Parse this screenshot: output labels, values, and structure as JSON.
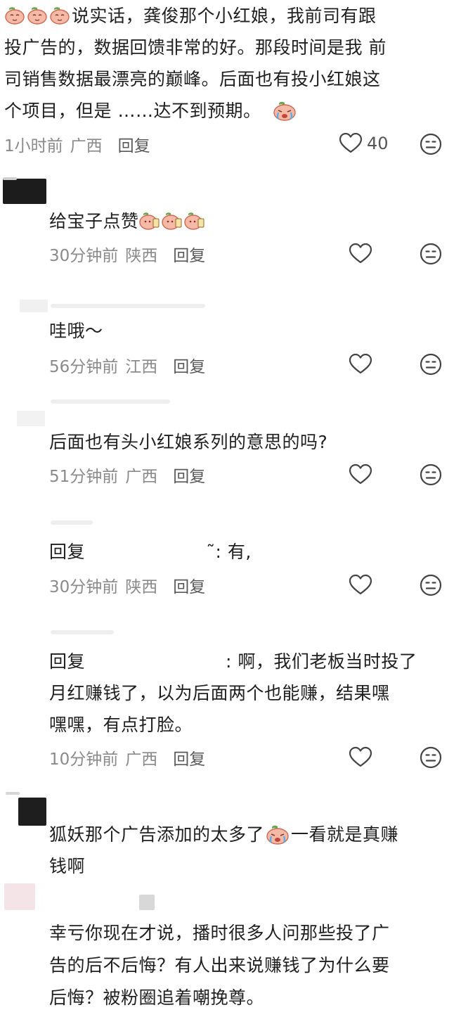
{
  "main_comment": {
    "lines": [
      "说实话，龚俊那个小红娘，我前司有跟",
      "投广告的，数据回馈非常的好。那段时间是我 前",
      "司销售数据最漂亮的巅峰。后面也有投小红娘这",
      "个项目，但是 ……达不到预期。"
    ],
    "time": "1小时前",
    "location": "广西",
    "reply_label": "回复",
    "likes": "40"
  },
  "replies": [
    {
      "text_lines": [
        "给宝子点赞"
      ],
      "time": "30分钟前",
      "location": "陕西",
      "reply_label": "回复"
    },
    {
      "text_lines": [
        "哇哦～"
      ],
      "time": "56分钟前",
      "location": "江西",
      "reply_label": "回复"
    },
    {
      "text_lines": [
        "后面也有头小红娘系列的意思的吗?"
      ],
      "time": "51分钟前",
      "location": "广西",
      "reply_label": "回复"
    },
    {
      "reply_prefix": "回复",
      "reply_suffix": "̃: 有,",
      "time": "30分钟前",
      "location": "陕西",
      "reply_label": "回复"
    },
    {
      "reply_prefix": "回复",
      "reply_suffix": ": 啊，我们老板当时投了",
      "text_lines": [
        "月红赚钱了，以为后面两个也能赚，结果嘿",
        "嘿嘿，有点打脸。"
      ],
      "time": "10分钟前",
      "location": "广西",
      "reply_label": "回复"
    },
    {
      "text_lines": [
        "狐妖那个广告添加的太多了",
        "钱啊"
      ],
      "inline_after_emoji": "一看就是真赚"
    },
    {
      "text_lines": [
        "幸亏你现在才说，播时很多人问那些投了广",
        "告的后不后悔？有人出来说赚钱了为什么要",
        "后悔？被粉圈追着嘲挽尊。"
      ]
    }
  ],
  "colors": {
    "text": "#1f1f1f",
    "meta": "#8a8a8a",
    "icon": "#444444"
  },
  "icons": [
    "peach-emoji-icon",
    "cry-emoji-icon",
    "heart-icon",
    "neutral-face-icon"
  ]
}
